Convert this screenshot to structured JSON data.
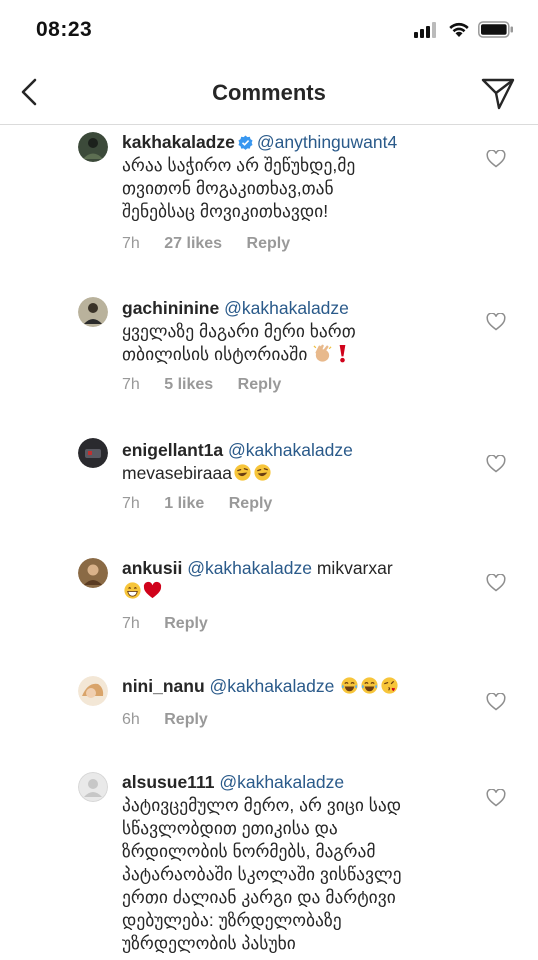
{
  "status_bar": {
    "time": "08:23"
  },
  "header": {
    "title": "Comments"
  },
  "comments": [
    {
      "username": "kakhakaladze",
      "mention": "@anythinguwant4",
      "lines": [
        "არაა საჭირო არ შეწუხდე,მე",
        "თვითონ მოგაკითხავ,თან",
        "შენებსაც მოვიკითხავდი!"
      ],
      "time": "7h",
      "likes": "27 likes",
      "reply": "Reply"
    },
    {
      "username": "gachininine",
      "mention": "@kakhakaladze",
      "lines": [
        "ყველაზე მაგარი მერი ხართ",
        "თბილისის ისტორიაში"
      ],
      "time": "7h",
      "likes": "5 likes",
      "reply": "Reply"
    },
    {
      "username": "enigellant1a",
      "mention": "@kakhakaladze",
      "lines": [
        "mevasebiraaa"
      ],
      "time": "7h",
      "likes": "1 like",
      "reply": "Reply"
    },
    {
      "username": "ankusii",
      "mention": "@kakhakaladze",
      "text": "mikvarxar",
      "time": "7h",
      "reply": "Reply"
    },
    {
      "username": "nini_nanu",
      "mention": "@kakhakaladze",
      "time": "6h",
      "reply": "Reply"
    },
    {
      "username": "alsusue111",
      "mention": "@kakhakaladze",
      "lines": [
        "პატივცემულო მერო, არ ვიცი სად",
        "სწავლობდით ეთიკისა და",
        "ზრდილობის ნორმებს, მაგრამ",
        "პატარაობაში სკოლაში ვისწავლე",
        "ერთი ძალიან კარგი და მარტივი",
        "დებულება: უზრდელობაზე",
        "უზრდელობის პასუხი"
      ]
    }
  ],
  "colors": {
    "mention": "#2a5a8a",
    "meta": "#999999",
    "heart_red": "#d0021b"
  }
}
